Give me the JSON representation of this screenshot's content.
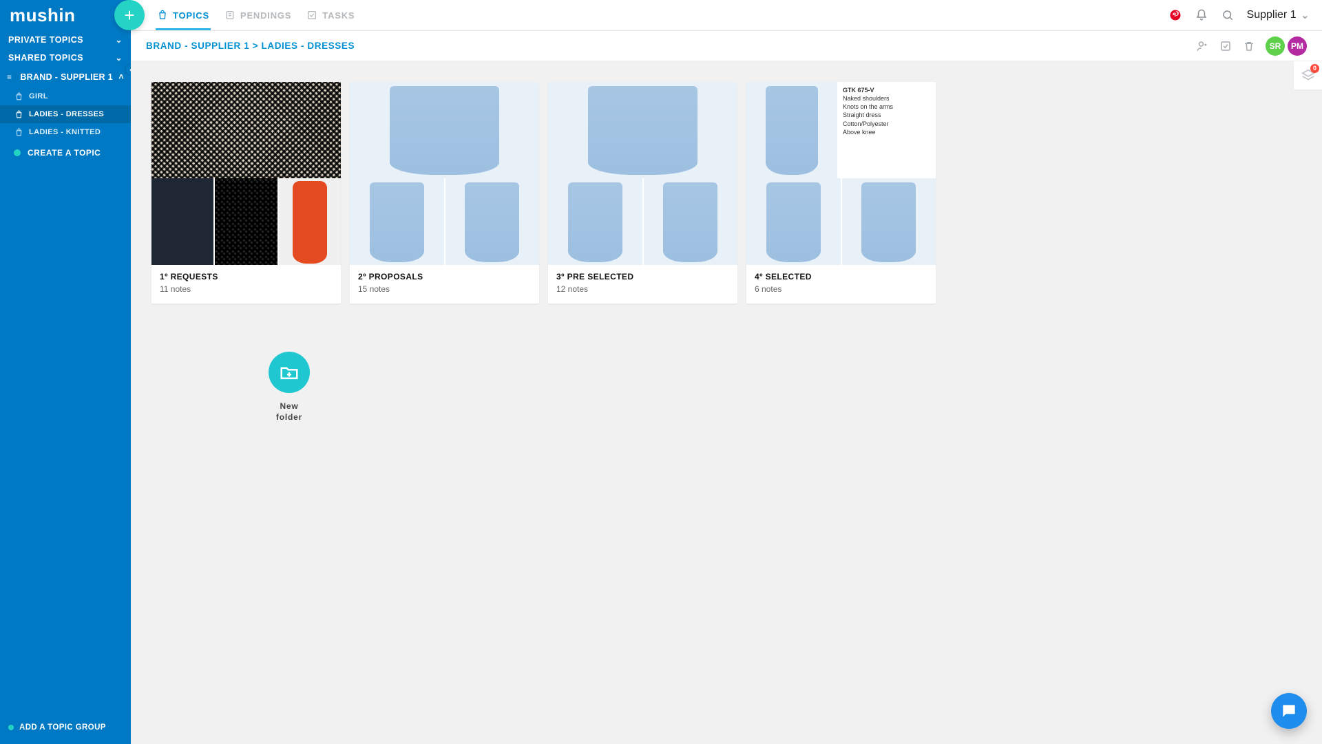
{
  "brand": "mushin",
  "topnav": {
    "tabs": [
      {
        "label": "TOPICS",
        "icon": "bag-icon",
        "active": true
      },
      {
        "label": "PENDINGS",
        "icon": "note-icon",
        "active": false
      },
      {
        "label": "TASKS",
        "icon": "check-icon",
        "active": false
      }
    ],
    "user": "Supplier 1"
  },
  "sidebar": {
    "sections": [
      {
        "label": "PRIVATE TOPICS"
      },
      {
        "label": "SHARED TOPICS"
      }
    ],
    "group": "BRAND - SUPPLIER 1",
    "topics": [
      {
        "label": "GIRL",
        "active": false
      },
      {
        "label": "LADIES - DRESSES",
        "active": true
      },
      {
        "label": "LADIES - KNITTED",
        "active": false
      }
    ],
    "create": "CREATE A TOPIC",
    "addGroup": "ADD A TOPIC GROUP"
  },
  "breadcrumb": "BRAND - SUPPLIER 1 > LADIES - DRESSES",
  "avatars": [
    {
      "initials": "SR",
      "color": "#5fd04a"
    },
    {
      "initials": "PM",
      "color": "#b42aa1"
    }
  ],
  "stackBadge": "0",
  "cards": [
    {
      "title": "1º REQUESTS",
      "notes": "11 notes"
    },
    {
      "title": "2º PROPOSALS",
      "notes": "15 notes"
    },
    {
      "title": "3º PRE SELECTED",
      "notes": "12 notes"
    },
    {
      "title": "4º SELECTED",
      "notes": "6 notes"
    }
  ],
  "spec": {
    "code": "GTK 675-V",
    "l1": "Naked shoulders",
    "l2": "Knots on the arms",
    "l3": "Straight dress",
    "l4": "Cotton/Polyester",
    "l5": "Above knee"
  },
  "newFolder": {
    "l1": "New",
    "l2": "folder"
  }
}
